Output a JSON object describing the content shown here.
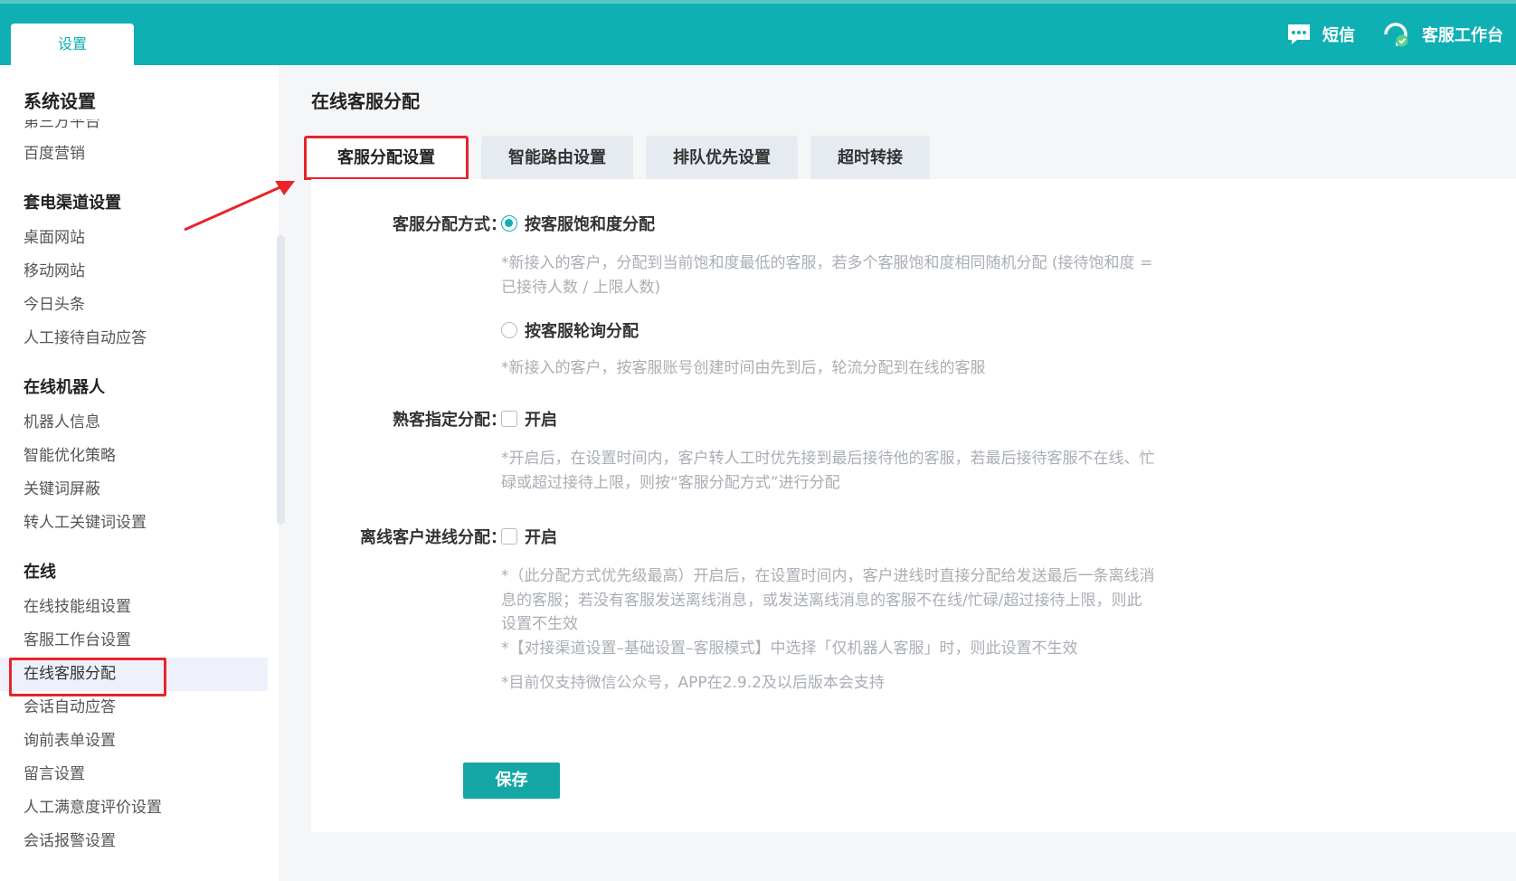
{
  "topbar": {
    "tab_label": "设置",
    "sms_label": "短信",
    "workbench_label": "客服工作台",
    "accent": "#0fb0b3"
  },
  "sidebar": {
    "title": "系统设置",
    "clipped_item": "第三方平台",
    "groups": [
      {
        "items": [
          "百度营销"
        ]
      },
      {
        "title": "套电渠道设置",
        "items": [
          "桌面网站",
          "移动网站",
          "今日头条",
          "人工接待自动应答"
        ]
      },
      {
        "title": "在线机器人",
        "items": [
          "机器人信息",
          "智能优化策略",
          "关键词屏蔽",
          "转人工关键词设置"
        ]
      },
      {
        "title": "在线",
        "items": [
          "在线技能组设置",
          "客服工作台设置",
          "在线客服分配",
          "会话自动应答",
          "询前表单设置",
          "留言设置",
          "人工满意度评价设置",
          "会话报警设置"
        ]
      }
    ]
  },
  "main": {
    "title": "在线客服分配",
    "tabs": [
      "客服分配设置",
      "智能路由设置",
      "排队优先设置",
      "超时转接"
    ],
    "assign_label": "客服分配方式：",
    "option1": "按客服饱和度分配",
    "option1_hint1": "*新接入的客户，分配到当前饱和度最低的客服，若多个客服饱和度相同随机分配 (接待饱和度 =",
    "option1_hint2": "已接待人数 / 上限人数)",
    "option2": "按客服轮询分配",
    "option2_hint": "*新接入的客户，按客服账号创建时间由先到后，轮流分配到在线的客服",
    "familiar_label": "熟客指定分配：",
    "familiar_option": "开启",
    "familiar_hint1": "*开启后，在设置时间内，客户转人工时优先接到最后接待他的客服，若最后接待客服不在线、忙",
    "familiar_hint2": "碌或超过接待上限，则按“客服分配方式”进行分配",
    "offline_label": "离线客户进线分配：",
    "offline_option": "开启",
    "offline_hint1": "*（此分配方式优先级最高）开启后，在设置时间内，客户进线时直接分配给发送最后一条离线消",
    "offline_hint2": "息的客服；若没有客服发送离线消息，或发送离线消息的客服不在线/忙碌/超过接待上限，则此",
    "offline_hint3": "设置不生效",
    "offline_hint4": "*【对接渠道设置–基础设置–客服模式】中选择「仅机器人客服」时，则此设置不生效",
    "offline_hint5": "*目前仅支持微信公众号，APP在2.9.2及以后版本会支持",
    "save_label": "保存",
    "selected_option": "按客服饱和度分配"
  },
  "highlight_color": "#e8242a"
}
